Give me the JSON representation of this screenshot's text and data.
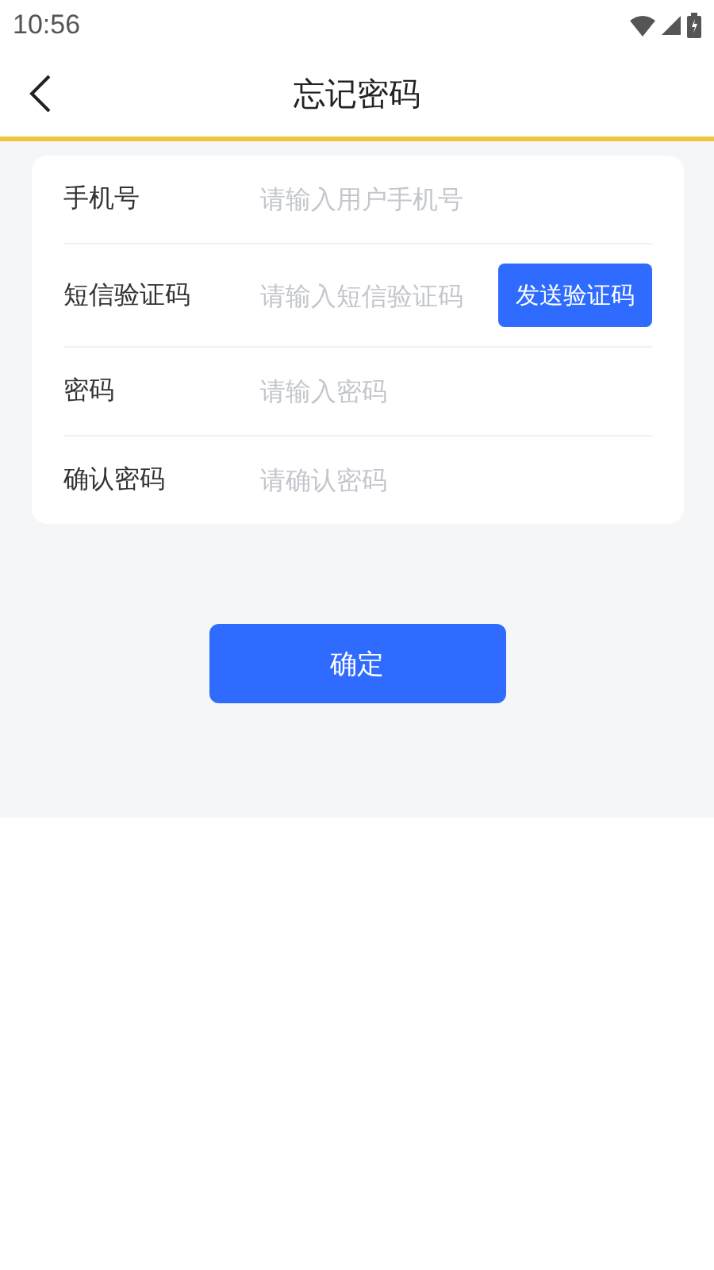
{
  "status_bar": {
    "time": "10:56"
  },
  "header": {
    "title": "忘记密码"
  },
  "form": {
    "rows": [
      {
        "kind": "plain",
        "label": "手机号",
        "placeholder": "请输入用户手机号"
      },
      {
        "kind": "code",
        "label": "短信验证码",
        "placeholder": "请输入短信验证码",
        "button": "发送验证码"
      },
      {
        "kind": "plain",
        "label": "密码",
        "placeholder": "请输入密码"
      },
      {
        "kind": "plain",
        "label": "确认密码",
        "placeholder": "请确认密码"
      }
    ]
  },
  "submit": {
    "label": "确定"
  }
}
